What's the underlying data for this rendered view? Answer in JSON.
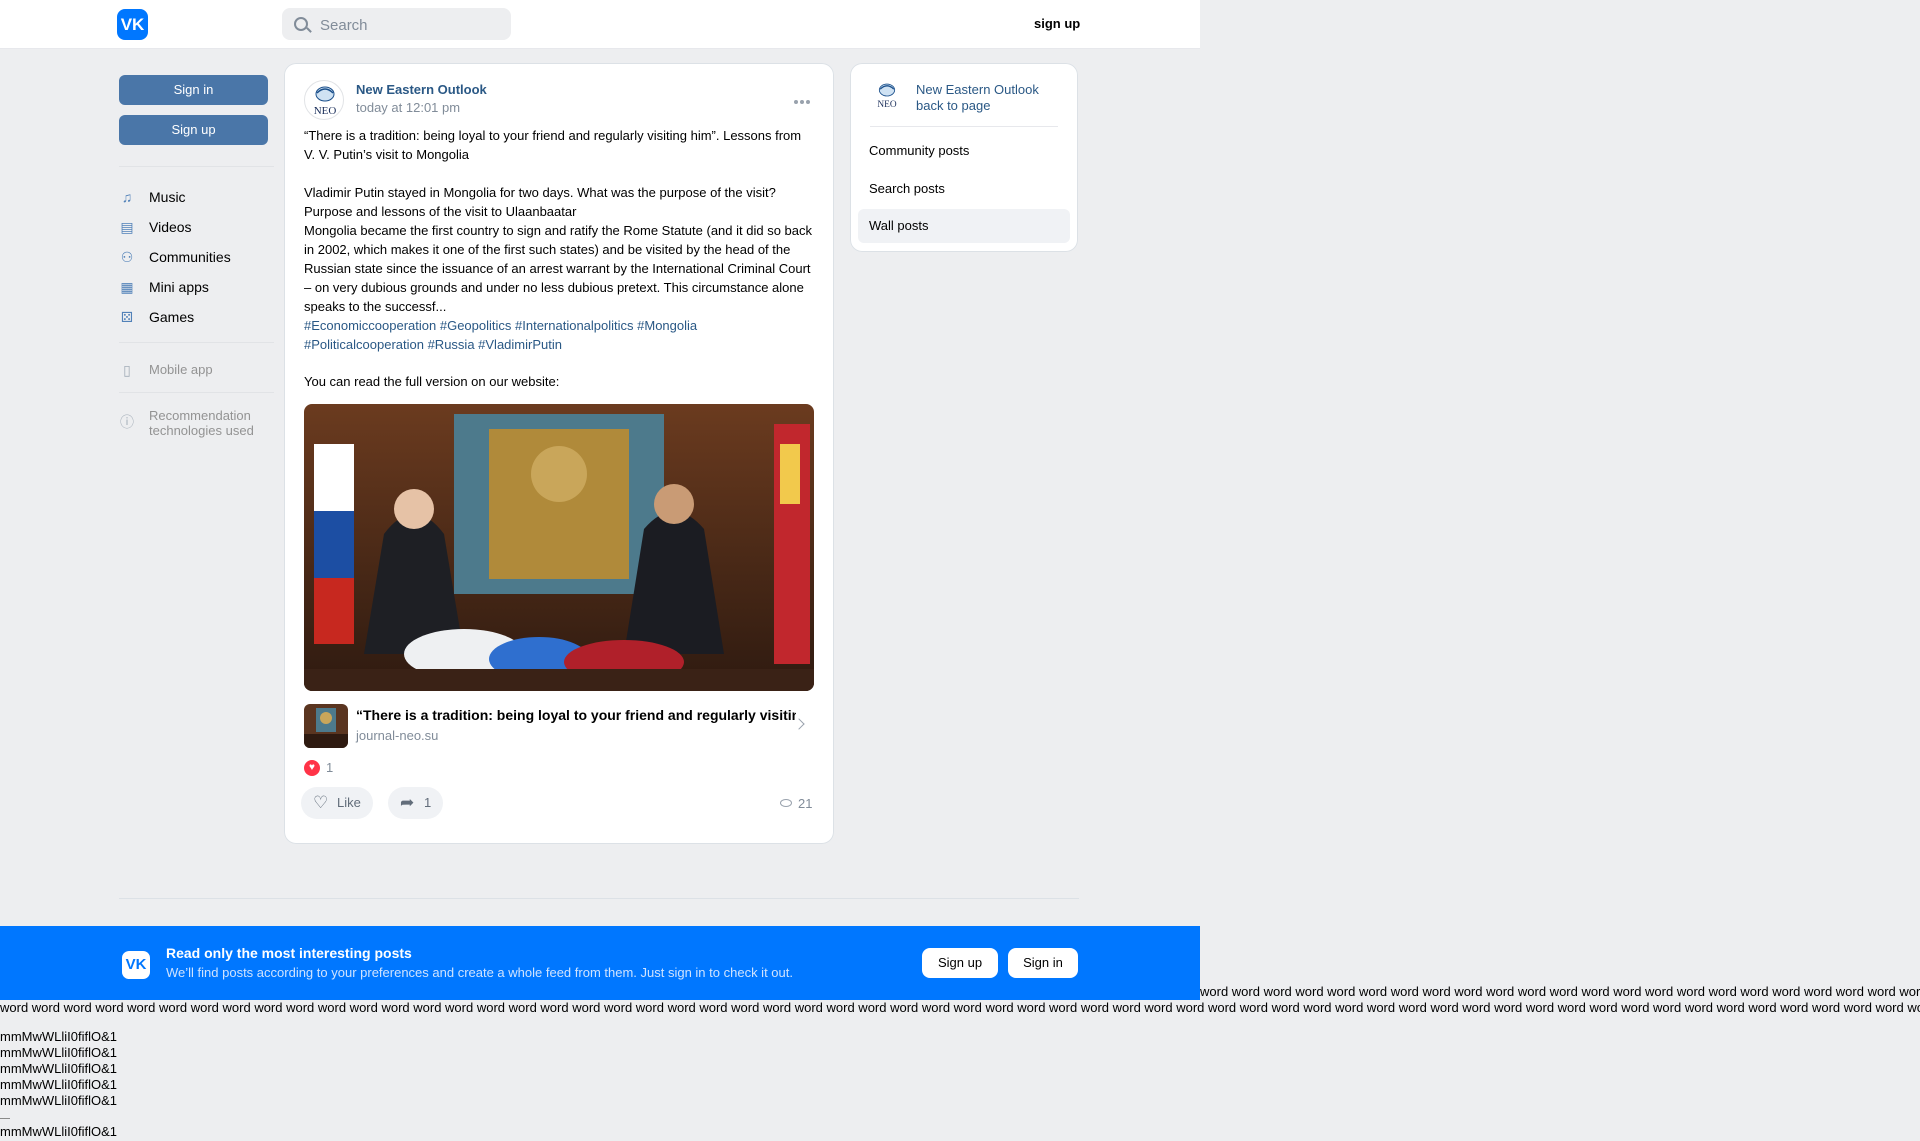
{
  "header": {
    "logo_text": "VK",
    "search_placeholder": "Search",
    "signup_label": "sign up"
  },
  "sidebar": {
    "signin_label": "Sign in",
    "signup_label": "Sign up",
    "items": [
      {
        "label": "Music",
        "icon": "music-icon"
      },
      {
        "label": "Videos",
        "icon": "video-icon"
      },
      {
        "label": "Communities",
        "icon": "communities-icon"
      },
      {
        "label": "Mini apps",
        "icon": "mini-apps-icon"
      },
      {
        "label": "Games",
        "icon": "gamepad-icon"
      }
    ],
    "mobile_app": "Mobile app",
    "recommendation": "Recommendation technologies used"
  },
  "post": {
    "author": "New Eastern Outlook",
    "time": "today at 12:01 pm",
    "avatar_text": "NEO",
    "text": "“There is a tradition: being loyal to your friend and regularly visiting him”. Lessons from V. V. Putin’s visit to Mongolia\n\nVladimir Putin stayed in Mongolia for two days. What was the purpose of the visit? Purpose and lessons of the visit to Ulaanbaatar\nMongolia became the first country to sign and ratify the Rome Statute (and it did so back in 2002, which makes it one of the first such states) and be visited by the head of the Russian state since the issuance of an arrest warrant by the International Criminal Court – on very dubious grounds and under no less dubious pretext. This circumstance alone speaks to the successf...",
    "hashtags": "#Economiccooperation #Geopolitics #Internationalpolitics #Mongolia #Politicalcooperation #Russia #VladimirPutin",
    "read_full": "You can read the full version on our website:",
    "link_title": "“There is a tradition: being loyal to your friend and regularly visiting him”. Lessons from V. V. Putin’s visit to Mongolia",
    "link_domain": "journal-neo.su",
    "reaction_count": "1",
    "like_label": "Like",
    "share_count": "1",
    "views": "21"
  },
  "right_panel": {
    "name": "New Eastern Outlook",
    "back": "back to page",
    "items": [
      "Community posts",
      "Search posts",
      "Wall posts"
    ]
  },
  "banner": {
    "title": "Read only the most interesting posts",
    "subtitle": "We’ll find posts according to your preferences and create a whole feed from them. Just sign in to check it out.",
    "signup_label": "Sign up",
    "signin_label": "Sign in"
  },
  "filler": {
    "word_line": "word word word word word word word word word word word word word word word word word word word word word word word word word word word word word word word word word word word word word word word word word word word word word word word word word word word word word word word word word word word word word word word word word word word word word word word word word word word word word word word word word word word word word word word word word word word word word word word word",
    "glyph_line": "mmMwWLliI0fiflO&1"
  },
  "colors": {
    "accent": "#0077ff",
    "button_blue": "#4a76a8",
    "link_blue": "#2a5885",
    "background": "#edeef0"
  }
}
